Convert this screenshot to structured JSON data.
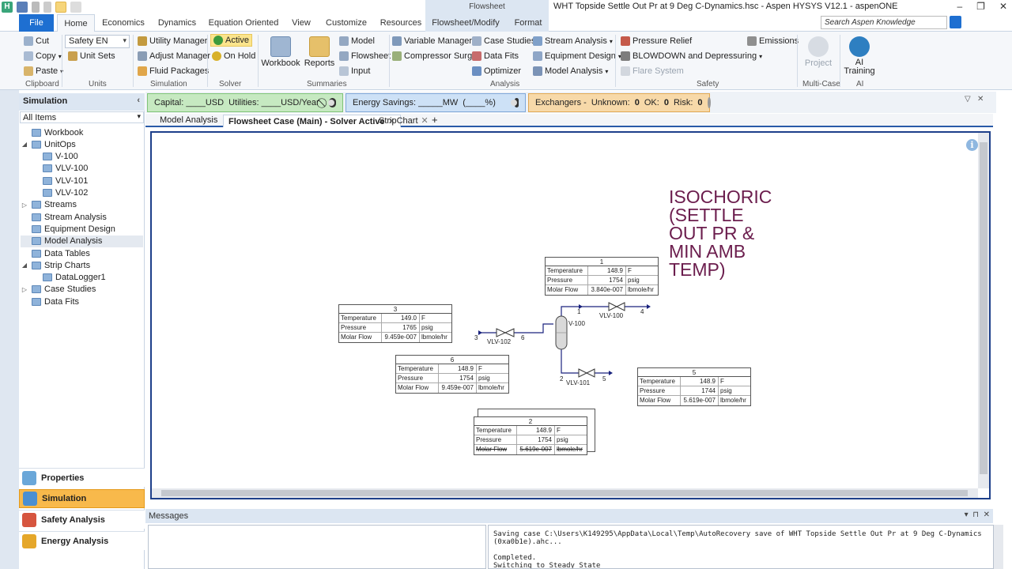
{
  "window": {
    "title": "WHT Topside Settle Out Pr at 9 Deg C-Dynamics.hsc - Aspen HYSYS V12.1 - aspenONE",
    "contextual_group": "Flowsheet",
    "controls": [
      "–",
      "❐",
      "✕"
    ]
  },
  "tabs": [
    "File",
    "Home",
    "Economics",
    "Dynamics",
    "Equation Oriented",
    "View",
    "Customize",
    "Resources",
    "Flowsheet/Modify",
    "Format"
  ],
  "search": {
    "placeholder": "Search Aspen Knowledge"
  },
  "ribbon": {
    "clipboard": {
      "cut": "Cut",
      "copy": "Copy",
      "paste": "Paste",
      "label": "Clipboard"
    },
    "units": {
      "set": "Safety EN",
      "unit_sets": "Unit Sets",
      "label": "Units"
    },
    "simulation": {
      "utility_manager": "Utility Manager",
      "adjust_manager": "Adjust Manager",
      "fluid_packages": "Fluid Packages",
      "label": "Simulation"
    },
    "solver": {
      "active": "Active",
      "on_hold": "On Hold",
      "label": "Solver"
    },
    "summaries": {
      "workbook": "Workbook",
      "reports": "Reports",
      "model": "Model",
      "flowsheet": "Flowsheet",
      "input": "Input",
      "label": "Summaries"
    },
    "analysis": {
      "variable_manager": "Variable Manager",
      "compressor_surge": "Compressor Surge",
      "case_studies": "Case Studies",
      "data_fits": "Data Fits",
      "optimizer": "Optimizer",
      "stream_analysis": "Stream Analysis",
      "equipment_design": "Equipment Design",
      "model_analysis": "Model Analysis",
      "label": "Analysis"
    },
    "safety": {
      "pressure_relief": "Pressure Relief",
      "blowdown": "BLOWDOWN and Depressuring",
      "flare_system": "Flare System",
      "emissions": "Emissions",
      "label": "Safety"
    },
    "multicase": {
      "project": "Project",
      "label": "Multi-Case"
    },
    "ai": {
      "training": "AI\nTraining",
      "label": "AI"
    }
  },
  "navigator": {
    "title": "Simulation",
    "filter": "All Items",
    "tree": [
      {
        "label": "Workbook",
        "level": 0,
        "expander": ""
      },
      {
        "label": "UnitOps",
        "level": 0,
        "expander": "◢"
      },
      {
        "label": "V-100",
        "level": 1,
        "expander": ""
      },
      {
        "label": "VLV-100",
        "level": 1,
        "expander": ""
      },
      {
        "label": "VLV-101",
        "level": 1,
        "expander": ""
      },
      {
        "label": "VLV-102",
        "level": 1,
        "expander": ""
      },
      {
        "label": "Streams",
        "level": 0,
        "expander": "▷"
      },
      {
        "label": "Stream Analysis",
        "level": 0,
        "expander": ""
      },
      {
        "label": "Equipment Design",
        "level": 0,
        "expander": ""
      },
      {
        "label": "Model Analysis",
        "level": 0,
        "expander": "",
        "selected": true
      },
      {
        "label": "Data Tables",
        "level": 0,
        "expander": ""
      },
      {
        "label": "Strip Charts",
        "level": 0,
        "expander": "◢"
      },
      {
        "label": "DataLogger1",
        "level": 1,
        "expander": ""
      },
      {
        "label": "Case Studies",
        "level": 0,
        "expander": "▷"
      },
      {
        "label": "Data Fits",
        "level": 0,
        "expander": ""
      }
    ],
    "nav_buttons": [
      {
        "label": "Properties",
        "selected": false,
        "color": "#6aa7d9"
      },
      {
        "label": "Simulation",
        "selected": true,
        "color": "#4b8fd1"
      },
      {
        "label": "Safety Analysis",
        "selected": false,
        "color": "#d6553f"
      },
      {
        "label": "Energy Analysis",
        "selected": false,
        "color": "#e5a72a"
      }
    ]
  },
  "status": {
    "capital": "Capital: ____USD",
    "utilities": "Utilities: ____USD/Year",
    "energy": "Energy Savings: _____MW",
    "energy_pct": "(____%)",
    "exchangers": "Exchangers -",
    "unknown_label": "Unknown:",
    "unknown": "0",
    "ok_label": "OK:",
    "ok": "0",
    "risk_label": "Risk:",
    "risk": "0"
  },
  "doc_tabs": [
    {
      "label": "Model Analysis",
      "active": false
    },
    {
      "label": "Flowsheet Case (Main) - Solver Active",
      "active": true
    },
    {
      "label": "StripChart",
      "active": false
    }
  ],
  "annotation": "ISOCHORIC\n(SETTLE\nOUT PR &\nMIN AMB\nTEMP)",
  "streams": {
    "s1": {
      "name": "1",
      "temperature": "148.9",
      "t_unit": "F",
      "pressure": "1754",
      "p_unit": "psig",
      "molar_flow": "3.840e-007",
      "f_unit": "lbmole/hr"
    },
    "s3": {
      "name": "3",
      "temperature": "149.0",
      "t_unit": "F",
      "pressure": "1765",
      "p_unit": "psig",
      "molar_flow": "9.459e-007",
      "f_unit": "lbmole/hr"
    },
    "s6": {
      "name": "6",
      "temperature": "148.9",
      "t_unit": "F",
      "pressure": "1754",
      "p_unit": "psig",
      "molar_flow": "9.459e-007",
      "f_unit": "lbmole/hr"
    },
    "s5": {
      "name": "5",
      "temperature": "148.9",
      "t_unit": "F",
      "pressure": "1744",
      "p_unit": "psig",
      "molar_flow": "5.619e-007",
      "f_unit": "lbmole/hr"
    },
    "s2": {
      "name": "2",
      "temperature": "148.9",
      "t_unit": "F",
      "pressure": "1754",
      "p_unit": "psig",
      "molar_flow": "5.619e-007",
      "f_unit": "lbmole/hr"
    }
  },
  "row_labels": {
    "temperature": "Temperature",
    "pressure": "Pressure",
    "molar_flow": "Molar Flow"
  },
  "flowsheet_labels": {
    "v100": "V-100",
    "vlv100": "VLV-100",
    "vlv101": "VLV-101",
    "vlv102": "VLV-102",
    "n1": "1",
    "n2": "2",
    "n3": "3",
    "n4": "4",
    "n5": "5",
    "n6": "6"
  },
  "messages": {
    "title": "Messages",
    "log": "Saving case C:\\Users\\K149295\\AppData\\Local\\Temp\\AutoRecovery save of WHT Topside Settle Out Pr at 9 Deg C-Dynamics\n(0xa0b1e).ahc...\n\nCompleted.\nSwitching to Steady State"
  }
}
